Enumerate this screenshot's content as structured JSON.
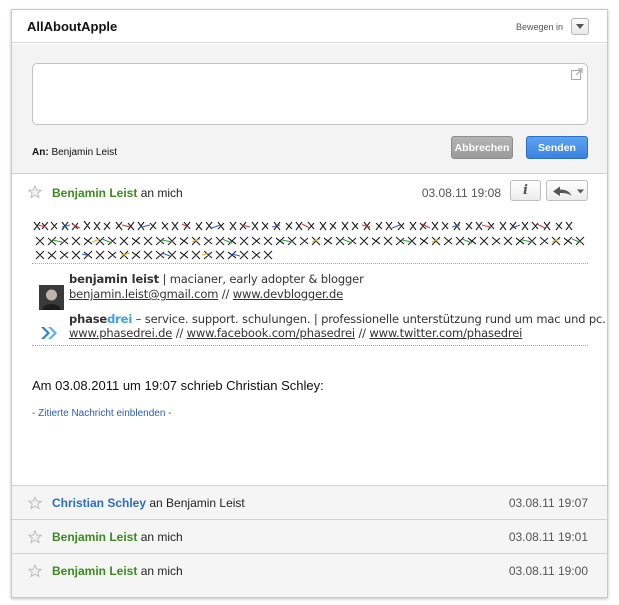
{
  "header": {
    "title": "AllAboutApple",
    "move_label": "Bewegen in"
  },
  "compose": {
    "to_label": "An:",
    "to_value": "Benjamin Leist",
    "cancel_label": "Abbrechen",
    "send_label": "Senden"
  },
  "open_message": {
    "sender": "Benjamin Leist",
    "recipient": "an mich",
    "timestamp": "03.08.11 19:08",
    "info_label": "i",
    "signature": {
      "name": "benjamin leist",
      "tagline": " | macianer, early adopter & blogger",
      "email": "benjamin.leist@gmail.com",
      "sep": " // ",
      "blog": "www.devblogger.de",
      "brand_a": "phase",
      "brand_b": "drei",
      "brand_tagline": " – service. support. schulungen. | professionelle unterstützung rund um mac und pc.",
      "link1": "www.phasedrei.de",
      "link2": "www.facebook.com/phasedrei",
      "link3": "www.twitter.com/phasedrei"
    },
    "quote_intro": "Am 03.08.2011 um 19:07 schrieb Christian Schley:",
    "show_quoted": "- Zitierte Nachricht einblenden -"
  },
  "thread": [
    {
      "sender": "Christian Schley",
      "recipient": "an Benjamin Leist",
      "time": "03.08.11 19:07"
    },
    {
      "sender": "Benjamin Leist",
      "recipient": "an mich",
      "time": "03.08.11 19:01"
    },
    {
      "sender": "Benjamin Leist",
      "recipient": "an mich",
      "time": "03.08.11 19:00"
    }
  ],
  "colors": {
    "accent_blue": "#3a83e0",
    "sender_green": "#3b8a1f",
    "sender_blue": "#2a6dc8",
    "brand_drei": "#3aa1dc"
  },
  "icons": [
    "star-icon",
    "popout-icon",
    "info-icon",
    "reply-icon",
    "chevron-down-icon",
    "avatar",
    "phasedrei-chevron-logo"
  ]
}
